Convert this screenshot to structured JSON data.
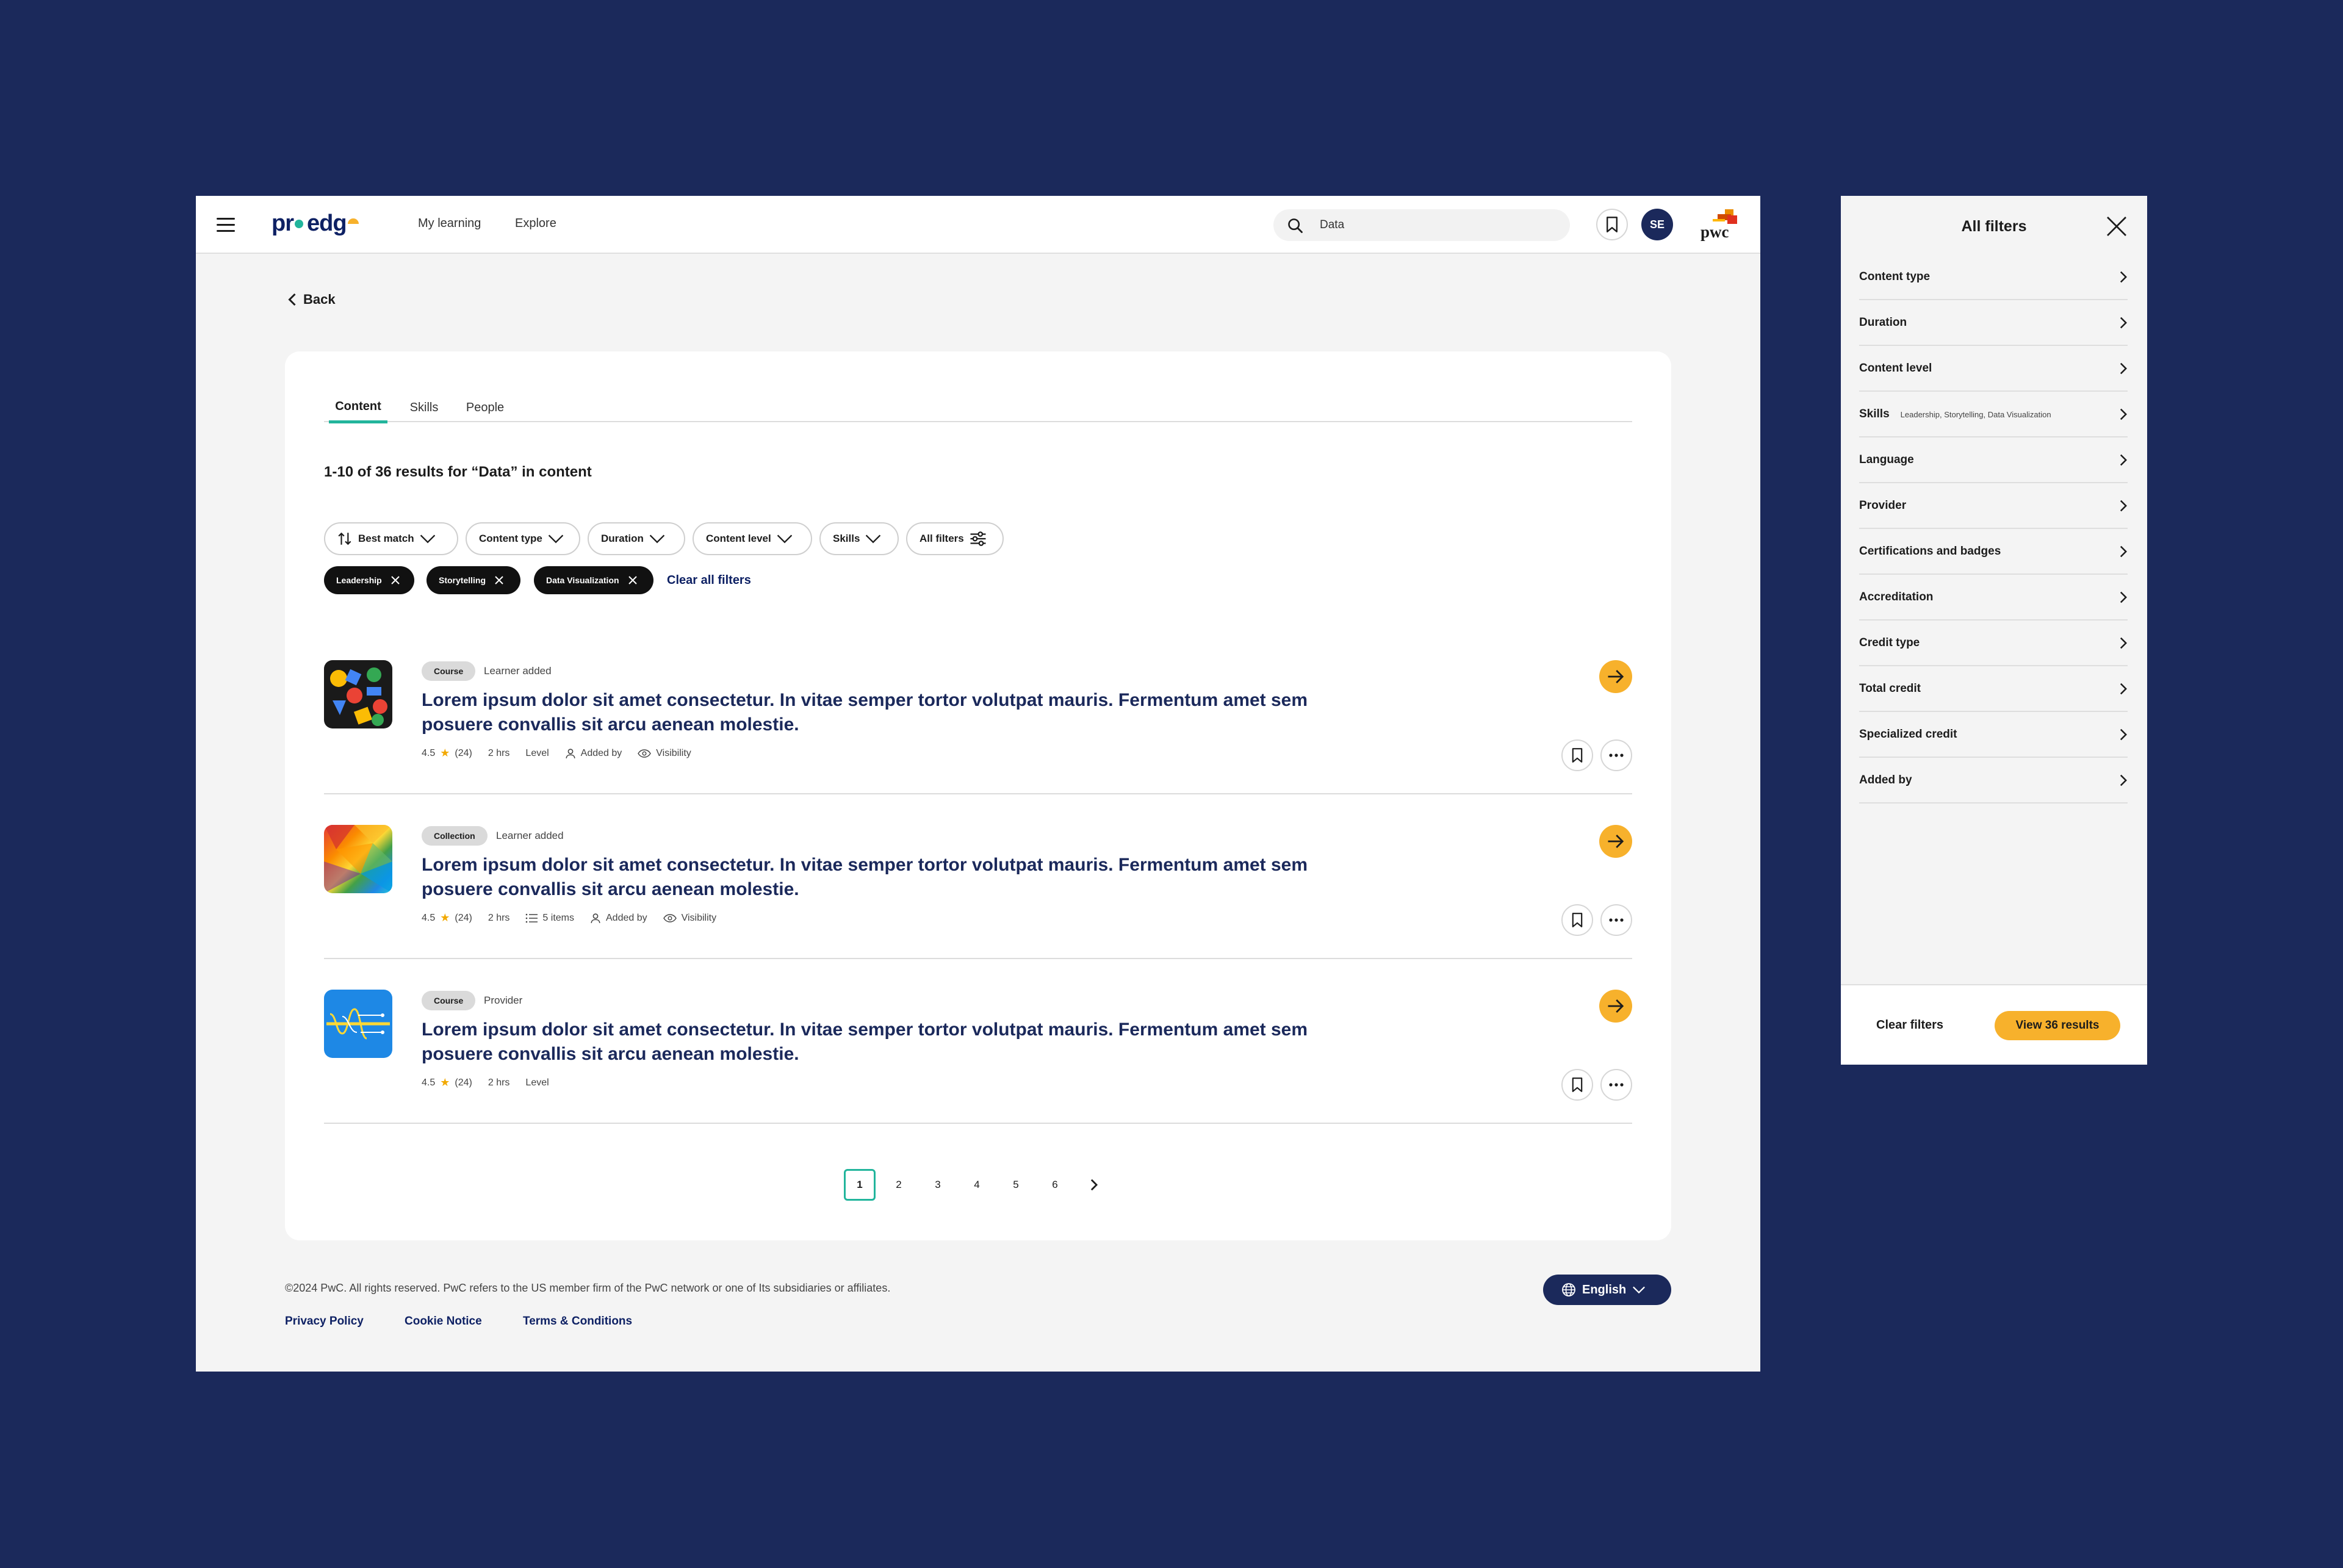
{
  "header": {
    "logo_text_1": "pr",
    "logo_text_2": "edg",
    "nav": [
      "My learning",
      "Explore"
    ],
    "search_value": "Data",
    "avatar_initials": "SE",
    "brand": "pwc"
  },
  "back_label": "Back",
  "tabs": [
    "Content",
    "Skills",
    "People"
  ],
  "active_tab": "Content",
  "results_text": "1-10 of 36 results for “Data” in content",
  "filters": {
    "sort": "Best match",
    "pills": [
      "Content type",
      "Duration",
      "Content level",
      "Skills"
    ],
    "all_filters": "All filters",
    "chips": [
      "Leadership",
      "Storytelling",
      "Data Visualization"
    ],
    "clear_all": "Clear all filters"
  },
  "items": [
    {
      "badge": "Course",
      "source": "Learner added",
      "title": "Lorem ipsum dolor sit amet consectetur. In vitae semper tortor volutpat mauris. Fermentum amet sem posuere convallis sit arcu aenean molestie.",
      "rating": "4.5",
      "reviews": "(24)",
      "duration": "2 hrs",
      "level": "Level",
      "added_by": "Added by",
      "visibility": "Visibility"
    },
    {
      "badge": "Collection",
      "source": "Learner added",
      "title": "Lorem ipsum dolor sit amet consectetur. In vitae semper tortor volutpat mauris. Fermentum amet sem posuere convallis sit arcu aenean molestie.",
      "rating": "4.5",
      "reviews": "(24)",
      "duration": "2 hrs",
      "items_count": "5 items",
      "added_by": "Added by",
      "visibility": "Visibility"
    },
    {
      "badge": "Course",
      "source": "Provider",
      "title": "Lorem ipsum dolor sit amet consectetur. In vitae semper tortor volutpat mauris. Fermentum amet sem posuere convallis sit arcu aenean molestie.",
      "rating": "4.5",
      "reviews": "(24)",
      "duration": "2 hrs",
      "level": "Level"
    }
  ],
  "pagination": {
    "pages": [
      "1",
      "2",
      "3",
      "4",
      "5",
      "6"
    ],
    "current": "1"
  },
  "footer": {
    "copyright": "©2024 PwC. All rights reserved. PwC refers to the US member firm of the PwC network or one of Its subsidiaries or affiliates.",
    "links": [
      "Privacy Policy",
      "Cookie Notice",
      "Terms & Conditions"
    ],
    "language": "English"
  },
  "panel": {
    "title": "All filters",
    "rows": [
      {
        "label": "Content type",
        "sub": ""
      },
      {
        "label": "Duration",
        "sub": ""
      },
      {
        "label": "Content level",
        "sub": ""
      },
      {
        "label": "Skills",
        "sub": "Leadership, Storytelling, Data Visualization"
      },
      {
        "label": "Language",
        "sub": ""
      },
      {
        "label": "Provider",
        "sub": ""
      },
      {
        "label": "Certifications and badges",
        "sub": ""
      },
      {
        "label": "Accreditation",
        "sub": ""
      },
      {
        "label": "Credit type",
        "sub": ""
      },
      {
        "label": "Total credit",
        "sub": ""
      },
      {
        "label": "Specialized credit",
        "sub": ""
      },
      {
        "label": "Added by",
        "sub": ""
      }
    ],
    "clear": "Clear filters",
    "view": "View 36 results"
  },
  "colors": {
    "background": "#1b295b",
    "accent_teal": "#22b59c",
    "accent_yellow": "#f7b12c",
    "title_navy": "#1b295b"
  }
}
